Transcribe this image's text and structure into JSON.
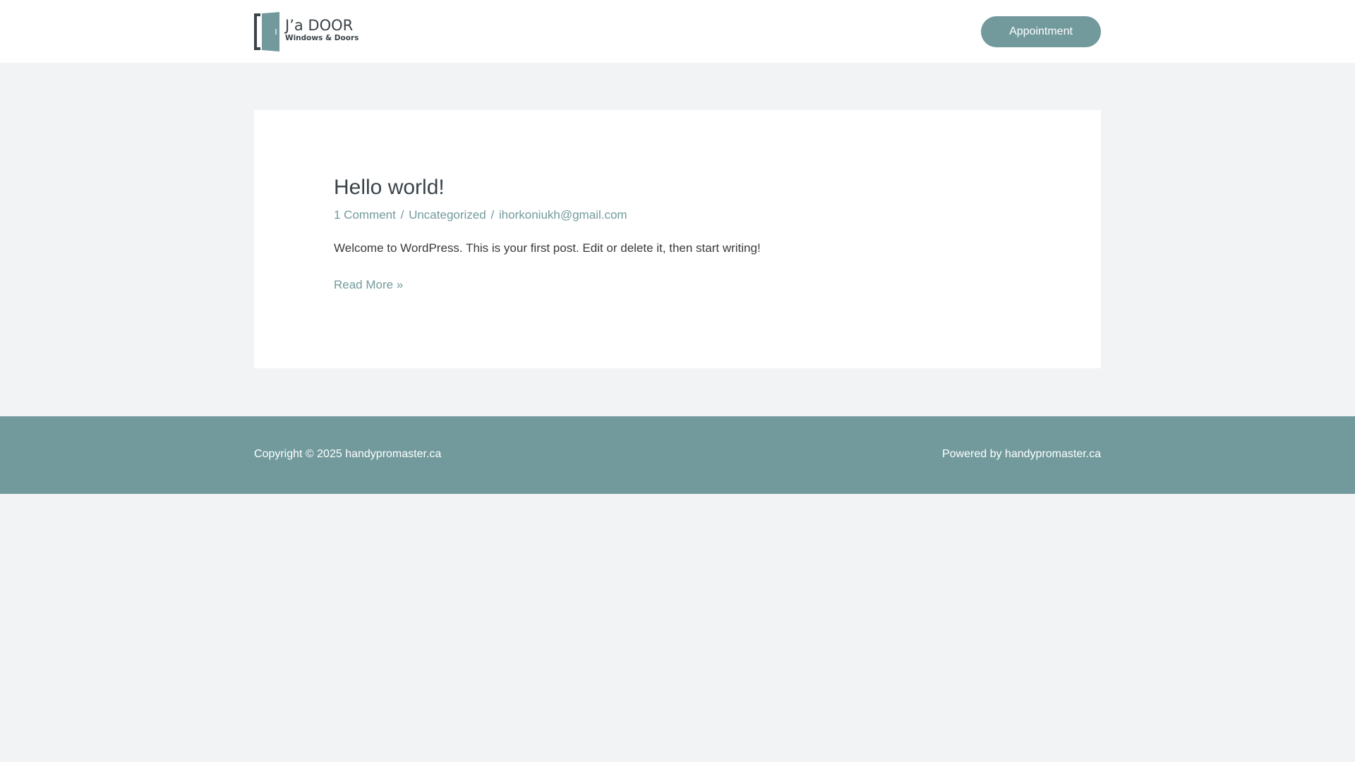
{
  "header": {
    "logo": {
      "brand": "J’a DOOR",
      "tagline": "Windows & Doors"
    },
    "appointment_label": "Appointment"
  },
  "post": {
    "title": "Hello world!",
    "meta": {
      "comments": "1 Comment",
      "separator": "/",
      "category": "Uncategorized",
      "author": "ihorkoniukh@gmail.com"
    },
    "excerpt": "Welcome to WordPress. This is your first post. Edit or delete it, then start writing!",
    "read_more": "Read More »"
  },
  "footer": {
    "copyright": "Copyright © 2025 handypromaster.ca",
    "powered_by": "Powered by handypromaster.ca"
  },
  "colors": {
    "accent": "#729a9d",
    "logo_dark": "#3a4349",
    "page_bg": "#f2f3f5",
    "card_bg": "#ffffff",
    "footer_text": "#ffffff"
  },
  "icons": {
    "logo": "door-logo-icon"
  }
}
